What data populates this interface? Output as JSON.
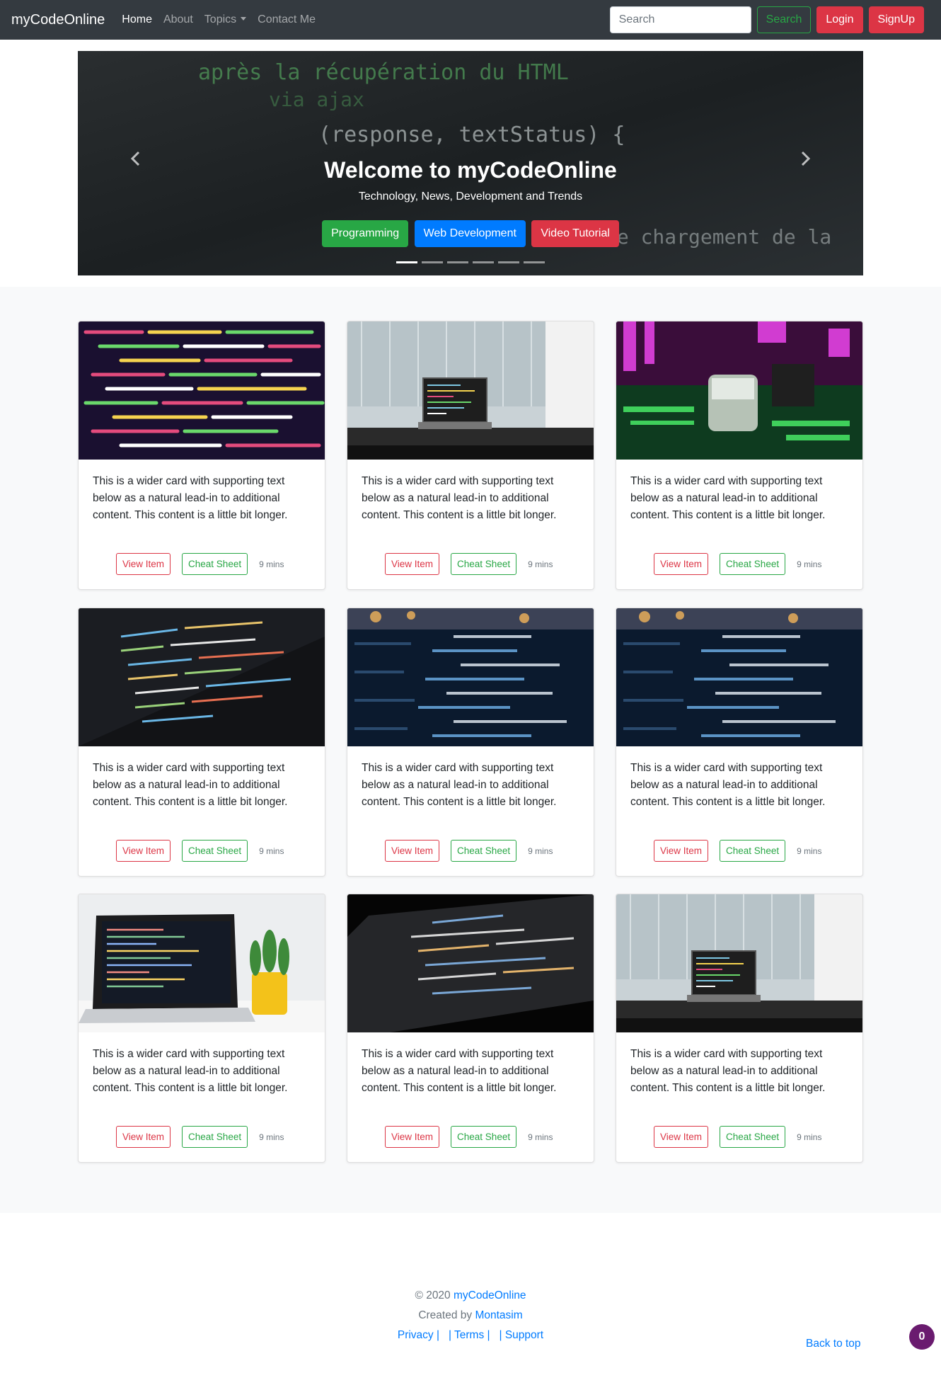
{
  "navbar": {
    "brand": "myCodeOnline",
    "links": [
      {
        "label": "Home",
        "active": true
      },
      {
        "label": "About",
        "active": false
      },
      {
        "label": "Topics",
        "active": false,
        "dropdown": true
      },
      {
        "label": "Contact Me",
        "active": false
      }
    ],
    "search_placeholder": "Search",
    "search_button": "Search",
    "login": "Login",
    "signup": "SignUp"
  },
  "carousel": {
    "background_code_text": [
      "après la récupération du HTML",
      "via ajax",
      "(response, textStatus) {",
      "de chargement de la"
    ],
    "title": "Welcome to myCodeOnline",
    "subtitle": "Technology, News, Development and Trends",
    "buttons": [
      "Programming",
      "Web Development",
      "Video Tutorial"
    ],
    "indicator_count": 6,
    "active_indicator": 0,
    "prev_icon": "chevron-left-icon",
    "next_icon": "chevron-right-icon"
  },
  "cards": [
    {
      "image": "colorful-code-screen",
      "text": "This is a wider card with supporting text below as a natural lead-in to additional content. This content is a little bit longer.",
      "view": "View Item",
      "cheat": "Cheat Sheet",
      "time": "9 mins"
    },
    {
      "image": "laptop-window",
      "text": "This is a wider card with supporting text below as a natural lead-in to additional content. This content is a little bit longer.",
      "view": "View Item",
      "cheat": "Cheat Sheet",
      "time": "9 mins"
    },
    {
      "image": "circuit-board",
      "text": "This is a wider card with supporting text below as a natural lead-in to additional content. This content is a little bit longer.",
      "view": "View Item",
      "cheat": "Cheat Sheet",
      "time": "9 mins"
    },
    {
      "image": "dark-code-monitor",
      "text": "This is a wider card with supporting text below as a natural lead-in to additional content. This content is a little bit longer.",
      "view": "View Item",
      "cheat": "Cheat Sheet",
      "time": "9 mins"
    },
    {
      "image": "blurred-code-blue",
      "text": "This is a wider card with supporting text below as a natural lead-in to additional content. This content is a little bit longer.",
      "view": "View Item",
      "cheat": "Cheat Sheet",
      "time": "9 mins"
    },
    {
      "image": "blurred-code-blue",
      "text": "This is a wider card with supporting text below as a natural lead-in to additional content. This content is a little bit longer.",
      "view": "View Item",
      "cheat": "Cheat Sheet",
      "time": "9 mins"
    },
    {
      "image": "laptop-plant-desk",
      "text": "This is a wider card with supporting text below as a natural lead-in to additional content. This content is a little bit longer.",
      "view": "View Item",
      "cheat": "Cheat Sheet",
      "time": "9 mins"
    },
    {
      "image": "angled-code-monitor",
      "text": "This is a wider card with supporting text below as a natural lead-in to additional content. This content is a little bit longer.",
      "view": "View Item",
      "cheat": "Cheat Sheet",
      "time": "9 mins"
    },
    {
      "image": "laptop-window",
      "text": "This is a wider card with supporting text below as a natural lead-in to additional content. This content is a little bit longer.",
      "view": "View Item",
      "cheat": "Cheat Sheet",
      "time": "9 mins"
    }
  ],
  "footer": {
    "copyright": "© 2020",
    "site_link": "myCodeOnline",
    "created_by": "Created by",
    "author": "Montasim",
    "privacy": "Privacy",
    "terms": "Terms",
    "support": "Support",
    "back_to_top": "Back to top",
    "badge_count": "0"
  },
  "colors": {
    "navbar": "#343a40",
    "danger": "#dc3545",
    "success": "#28a745",
    "primary": "#007bff",
    "badge": "#6a1b6f"
  }
}
